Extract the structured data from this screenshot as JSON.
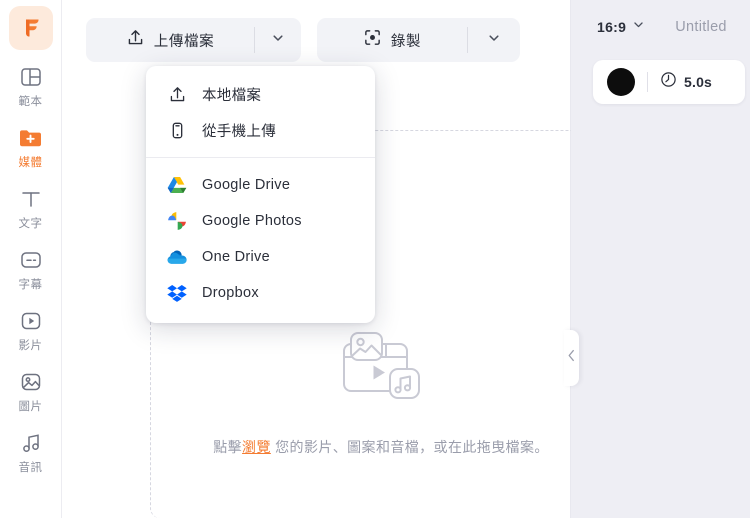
{
  "brand": {
    "logo_letter": "F",
    "accent": "#f47c32",
    "logo_bg": "#fdeadc"
  },
  "sidebar": {
    "items": [
      {
        "label": "範本",
        "icon": "template-icon",
        "active": false
      },
      {
        "label": "媒體",
        "icon": "media-folder-plus-icon",
        "active": true
      },
      {
        "label": "文字",
        "icon": "text-icon",
        "active": false
      },
      {
        "label": "字幕",
        "icon": "subtitle-icon",
        "active": false
      },
      {
        "label": "影片",
        "icon": "video-icon",
        "active": false
      },
      {
        "label": "圖片",
        "icon": "image-icon",
        "active": false
      },
      {
        "label": "音訊",
        "icon": "audio-icon",
        "active": false
      }
    ]
  },
  "toolbar": {
    "upload": {
      "label": "上傳檔案",
      "icon": "upload-arrow-icon",
      "caret": "chevron-down-icon"
    },
    "record": {
      "label": "錄製",
      "icon": "record-focus-icon",
      "caret": "chevron-down-icon"
    }
  },
  "upload_menu": {
    "groups": [
      {
        "items": [
          {
            "label": "本地檔案",
            "icon": "upload-arrow-icon"
          },
          {
            "label": "從手機上傳",
            "icon": "mobile-phone-icon"
          }
        ]
      },
      {
        "items": [
          {
            "label": "Google Drive",
            "icon": "google-drive-icon"
          },
          {
            "label": "Google Photos",
            "icon": "google-photos-icon"
          },
          {
            "label": "One Drive",
            "icon": "onedrive-icon"
          },
          {
            "label": "Dropbox",
            "icon": "dropbox-icon"
          }
        ]
      }
    ]
  },
  "dropzone": {
    "icon": "media-placeholder-icon",
    "text_before": "點擊",
    "link": "瀏覽",
    "text_after": " 您的影片、圖案和音檔，或在此拖曳檔案。"
  },
  "collapse": {
    "icon": "chevron-left-icon"
  },
  "stage": {
    "ratio": "16:9",
    "ratio_caret": "chevron-down-icon",
    "title": "Untitled",
    "clip": {
      "swatch_color": "#0d0d0d",
      "duration_icon": "clock-icon",
      "duration": "5.0s"
    }
  }
}
